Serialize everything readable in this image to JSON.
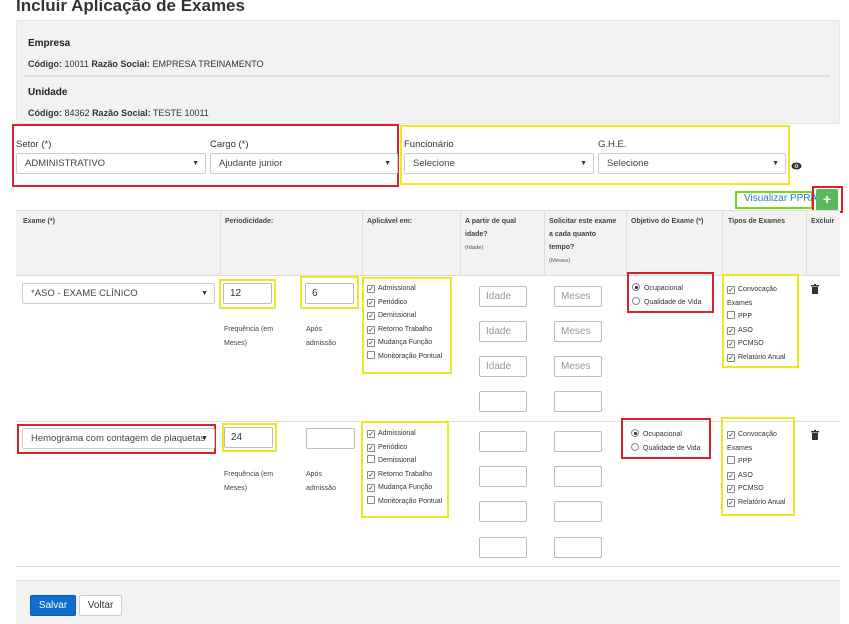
{
  "page": {
    "title": "Incluir Aplicação de Exames"
  },
  "empresa": {
    "heading": "Empresa",
    "codigo_label": "Código:",
    "codigo": "10011",
    "razao_label": "Razão Social:",
    "razao": "EMPRESA TREINAMENTO"
  },
  "unidade": {
    "heading": "Unidade",
    "codigo_label": "Código:",
    "codigo": "84362",
    "razao_label": "Razão Social:",
    "razao": "TESTE 10011"
  },
  "filters": {
    "setor": {
      "label": "Setor (*)",
      "value": "ADMINISTRATIVO"
    },
    "cargo": {
      "label": "Cargo (*)",
      "value": "Ajudante junior"
    },
    "funcionario": {
      "label": "Funcionário",
      "value": "Selecione"
    },
    "ghe": {
      "label": "G.H.E.",
      "value": "Selecione"
    }
  },
  "actions": {
    "visualizar": "Visualizar PPRA",
    "add": "+"
  },
  "table": {
    "headers": {
      "exame": "Exame (*)",
      "periodicidade": "Periodicidade:",
      "aplicavel": "Aplicável em:",
      "idade_1": "A partir de qual",
      "idade_2": "idade?",
      "idade_sub": "(Idade)",
      "solicitar_1": "Solicitar este exame",
      "solicitar_2": "a cada quanto",
      "solicitar_3": "tempo?",
      "solicitar_sub": "(Meses)",
      "objetivo": "Objetivo do Exame (*)",
      "tipos": "Tipos de Exames",
      "excluir": "Excluir"
    },
    "placeholders": {
      "idade": "Idade",
      "meses": "Meses"
    },
    "freq_label_1": "Frequência (em",
    "freq_label_2": "Meses)",
    "apos_label_1": "Após",
    "apos_label_2": "admissão",
    "aplicavel_options": [
      "Admissional",
      "Periódico",
      "Demissional",
      "Retorno Trabalho",
      "Mudança Função",
      "Monitoração Pontual"
    ],
    "objetivo_options": [
      "Ocupacional",
      "Qualidade de Vida"
    ],
    "tipos_options": [
      "Convocação",
      "Exames",
      "PPP",
      "ASO",
      "PCMSO",
      "Relatório Anual"
    ],
    "rows": [
      {
        "exame": "*ASO - EXAME CLÍNICO",
        "frequencia": "12",
        "apos": "6",
        "aplicavel_checked": [
          true,
          true,
          true,
          true,
          true,
          false
        ],
        "tipos_checked": [
          true,
          false,
          true,
          true,
          true
        ]
      },
      {
        "exame": "Hemograma com contagem de plaquetas",
        "frequencia": "24",
        "apos": "",
        "aplicavel_checked": [
          true,
          true,
          false,
          true,
          true,
          false
        ],
        "tipos_checked": [
          true,
          false,
          true,
          true,
          true
        ]
      }
    ]
  },
  "footer": {
    "salvar": "Salvar",
    "voltar": "Voltar"
  },
  "colors": {
    "highlight_red": "#d9232b",
    "highlight_yellow": "#eaea1e",
    "highlight_green": "#7cd61a",
    "primary": "#0d6ecd",
    "success": "#5cb85c"
  }
}
